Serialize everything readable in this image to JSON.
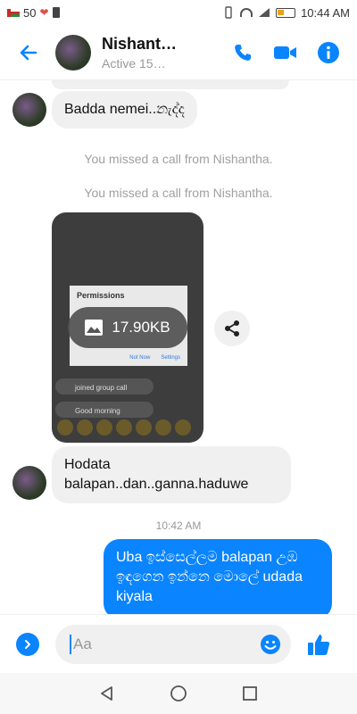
{
  "status_bar": {
    "signal_count": "50",
    "time": "10:44 AM"
  },
  "header": {
    "contact_name": "Nishant…",
    "active_status": "Active 15…"
  },
  "messages": {
    "msg1": "Badda nemei..නැද්ද",
    "missed_call_1": "You missed a call from Nishantha.",
    "missed_call_2": "You missed a call from Nishantha.",
    "image": {
      "size_label": "17.90KB",
      "preview_title": "Permissions",
      "preview_button_left": "Not Now",
      "preview_button_right": "Settings",
      "preview_row_1": "joined group call",
      "preview_row_2": "Good morning"
    },
    "msg2_line1": "Hodata",
    "msg2_line2": "balapan..dan..ganna.haduwe",
    "timestamp": "10:42 AM",
    "msg3": "Uba ඉස්සෙල්ලම balapan උඹ ඉඳගෙන ඉන්නෙ මොලේ udada kiyala"
  },
  "composer": {
    "placeholder": "Aa"
  },
  "colors": {
    "accent": "#0a84ff",
    "incoming_bubble": "#f1f0f0",
    "system_text": "#a0a0a0"
  },
  "icons": {
    "back": "arrow-left-icon",
    "call": "phone-icon",
    "video": "video-camera-icon",
    "info": "info-icon",
    "share": "share-icon",
    "image": "image-icon",
    "expand": "chevron-right-icon",
    "emoji": "smiley-icon",
    "like": "thumbs-up-icon"
  }
}
